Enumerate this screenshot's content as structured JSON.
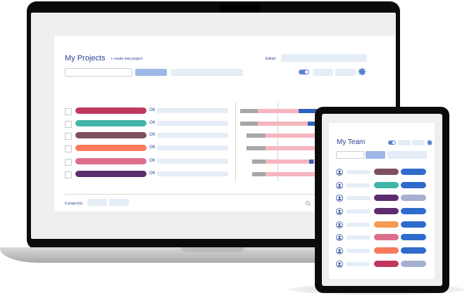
{
  "projects": {
    "title": "My Projects",
    "create_link": "+ create new project",
    "edited_label": "Edited",
    "count_text": "6 project(s)",
    "rows": [
      {
        "color": "#c0385e",
        "status": "OK"
      },
      {
        "color": "#40b5a8",
        "status": "OK"
      },
      {
        "color": "#7e4f5d",
        "status": "OK"
      },
      {
        "color": "#f77a5a",
        "status": "OK"
      },
      {
        "color": "#dd6f8c",
        "status": "OK"
      },
      {
        "color": "#5c2d6e",
        "status": "OK"
      }
    ]
  },
  "team": {
    "title": "My Team",
    "members": [
      {
        "tag_color": "#7e4f5d",
        "role_color": "#2f6bcb"
      },
      {
        "tag_color": "#40b5a8",
        "role_color": "#2f6bcb"
      },
      {
        "tag_color": "#5c2d6e",
        "role_color": "#a5b0cf"
      },
      {
        "tag_color": "#5c2d6e",
        "role_color": "#2f6bcb"
      },
      {
        "tag_color": "#f59a52",
        "role_color": "#2f6bcb"
      },
      {
        "tag_color": "#dd6f8c",
        "role_color": "#2f6bcb"
      },
      {
        "tag_color": "#f77a5a",
        "role_color": "#2f6bcb"
      },
      {
        "tag_color": "#c0385e",
        "role_color": "#a5b0cf"
      }
    ]
  },
  "colors": {
    "accent_blue": "#2a3f93",
    "gantt_gray": "#a7a7a7",
    "gantt_pink": "#f6b6bf",
    "gantt_blue": "#2f62bf"
  }
}
